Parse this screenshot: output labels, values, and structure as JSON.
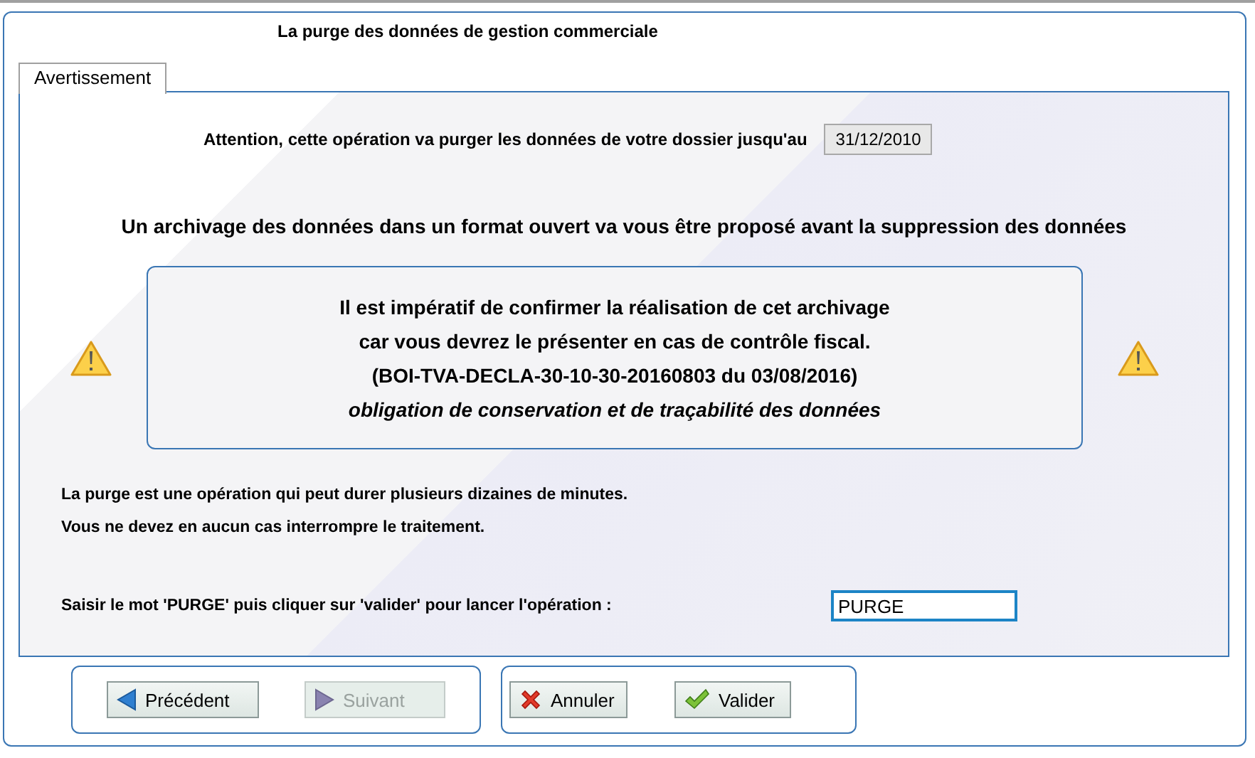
{
  "dialog": {
    "title": "La purge des données de gestion commerciale"
  },
  "tabs": [
    {
      "label": "Avertissement",
      "selected": true
    }
  ],
  "warning": {
    "text": "Attention, cette opération va purger les données de votre dossier jusqu'au",
    "date": "31/12/2010"
  },
  "headline": "Un archivage des données dans un format ouvert va vous être proposé avant la suppression des données",
  "notice": {
    "lines": [
      {
        "text": "Il est impératif de confirmer la réalisation de cet archivage",
        "kind": "bold"
      },
      {
        "text": "car vous devrez le présenter en cas de contrôle fiscal.",
        "kind": "bold"
      },
      {
        "text": "(BOI-TVA-DECLA-30-10-30-20160803 du 03/08/2016)",
        "kind": "bold"
      },
      {
        "text": "obligation de conservation et de traçabilité des données",
        "kind": "italic"
      }
    ]
  },
  "info_lines": [
    "La purge est une opération qui peut durer plusieurs dizaines de minutes.",
    "Vous ne devez en aucun cas interrompre le traitement."
  ],
  "confirm": {
    "label": "Saisir le mot 'PURGE' puis cliquer sur 'valider' pour lancer l'opération :",
    "value": "PURGE"
  },
  "nav_buttons": [
    {
      "label": "Précédent",
      "kind": "back",
      "disabled": false
    },
    {
      "label": "Suivant",
      "kind": "next",
      "disabled": true
    }
  ],
  "action_buttons": [
    {
      "label": "Annuler",
      "kind": "cancel"
    },
    {
      "label": "Valider",
      "kind": "confirm"
    }
  ]
}
